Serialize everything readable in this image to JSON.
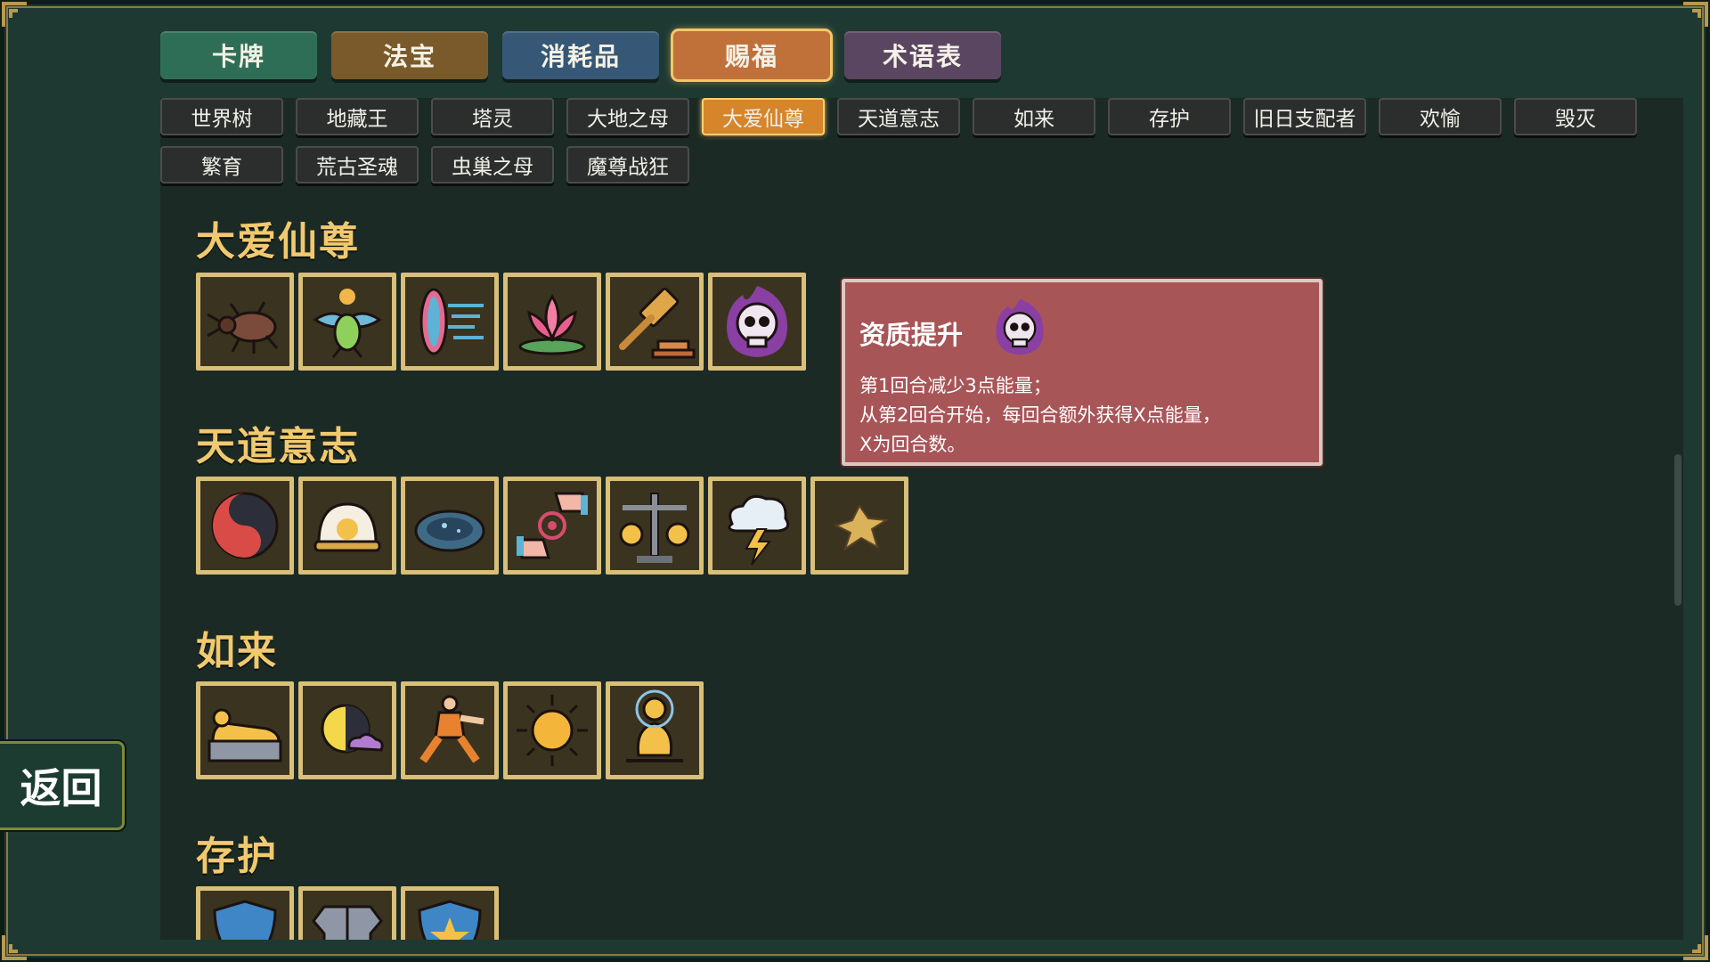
{
  "main_tabs": [
    {
      "label": "卡牌",
      "color": "#2f6e56"
    },
    {
      "label": "法宝",
      "color": "#7a5a2a"
    },
    {
      "label": "消耗品",
      "color": "#365775"
    },
    {
      "label": "赐福",
      "color": "#c0713a",
      "active": true
    },
    {
      "label": "术语表",
      "color": "#5a4660"
    }
  ],
  "sub_tabs": [
    {
      "label": "世界树"
    },
    {
      "label": "地藏王"
    },
    {
      "label": "塔灵"
    },
    {
      "label": "大地之母"
    },
    {
      "label": "大爱仙尊",
      "active": true
    },
    {
      "label": "天道意志"
    },
    {
      "label": "如来"
    },
    {
      "label": "存护"
    },
    {
      "label": "旧日支配者"
    },
    {
      "label": "欢愉"
    },
    {
      "label": "毁灭"
    },
    {
      "label": "繁育"
    },
    {
      "label": "荒古圣魂"
    },
    {
      "label": "虫巢之母"
    },
    {
      "label": "魔尊战狂"
    }
  ],
  "sections": [
    {
      "title": "大爱仙尊",
      "icons": [
        "beetle-icon",
        "scarab-icon",
        "speed-shield-icon",
        "lotus-icon",
        "gavel-icon",
        "purple-skull-icon"
      ]
    },
    {
      "title": "天道意志",
      "icons": [
        "yin-yang-fish-icon",
        "golden-sun-orb-icon",
        "dark-orb-icon",
        "hands-target-icon",
        "balance-scale-icon",
        "thunder-cloud-icon",
        "crack-icon"
      ]
    },
    {
      "title": "如来",
      "icons": [
        "reclining-buddha-icon",
        "moon-cloud-icon",
        "monk-fighter-icon",
        "sun-icon",
        "meditating-buddha-icon"
      ]
    },
    {
      "title": "存护",
      "icons": [
        "blue-shield-icon",
        "armor-icon",
        "star-shield-icon"
      ]
    }
  ],
  "tooltip": {
    "title": "资质提升",
    "icon": "purple-skull-icon",
    "lines": [
      "第1回合减少3点能量；",
      "从第2回合开始，每回合额外获得X点能量，",
      "X为回合数。"
    ]
  },
  "back_label": "返回"
}
